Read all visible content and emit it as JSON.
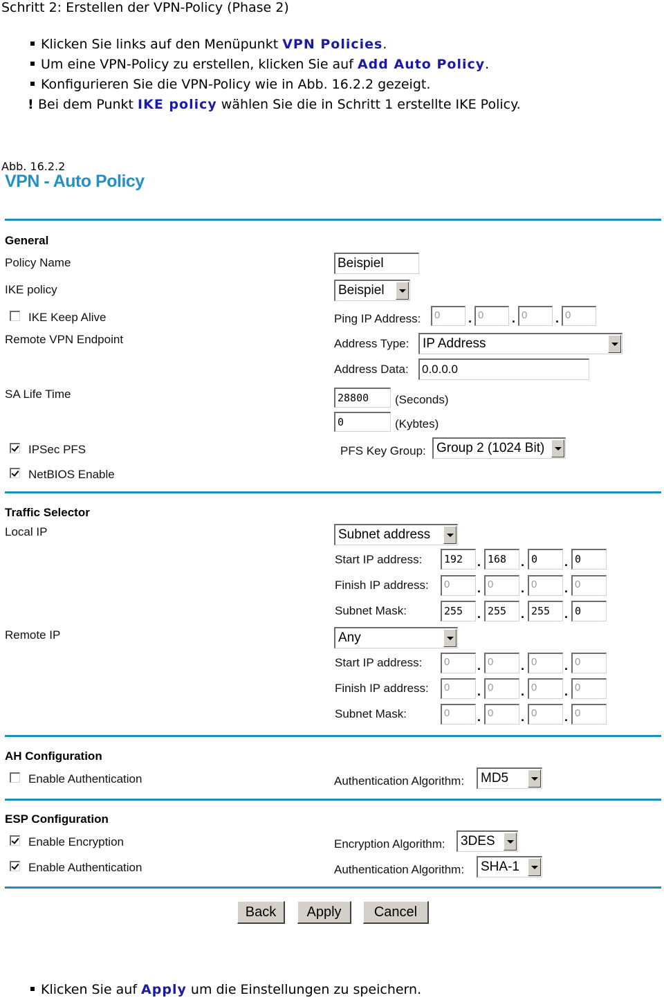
{
  "doc": {
    "title": "Schritt 2: Erstellen der VPN-Policy (Phase 2)",
    "bullets": [
      {
        "before": "Klicken Sie links auf den Menüpunkt ",
        "keyword": "VPN Policies",
        "after": "."
      },
      {
        "before": "Um eine VPN-Policy zu erstellen, klicken Sie auf ",
        "keyword": "Add Auto Policy",
        "after": "."
      },
      {
        "before": "Konfigurieren Sie die VPN-Policy wie in Abb. 16.2.2 gezeigt.",
        "keyword": "",
        "after": ""
      }
    ],
    "note": {
      "mark": "!",
      "before": "Bei dem Punkt ",
      "keyword": "IKE policy",
      "after": " wählen Sie die in Schritt 1 erstellte IKE Policy."
    },
    "caption": "Abb. 16.2.2",
    "footer_bullet": {
      "before": "Klicken Sie auf ",
      "keyword": "Apply",
      "after": " um die Einstellungen zu speichern."
    }
  },
  "colors": {
    "title": "#2391c4",
    "rule": "#1e8fbd",
    "keyword": "#1a1aa6"
  },
  "form": {
    "page_title": "VPN - Auto Policy",
    "general": {
      "heading": "General",
      "policy_name_label": "Policy Name",
      "policy_name_value": "Beispiel",
      "ike_policy_label": "IKE policy",
      "ike_policy_value": "Beispiel",
      "ike_keep_alive_label": "IKE Keep Alive",
      "ike_keep_alive_checked": false,
      "ping_ip_label": "Ping IP Address:",
      "ping_ip": [
        "0",
        "0",
        "0",
        "0"
      ],
      "remote_endpoint_label": "Remote VPN Endpoint",
      "address_type_label": "Address Type:",
      "address_type_value": "IP Address",
      "address_data_label": "Address Data:",
      "address_data_value": "0.0.0.0",
      "sa_life_label": "SA Life Time",
      "sa_seconds_value": "28800",
      "sa_seconds_unit": "(Seconds)",
      "sa_kbytes_value": "0",
      "sa_kbytes_unit": "(Kybtes)",
      "ipsec_pfs_label": "IPSec PFS",
      "ipsec_pfs_checked": true,
      "pfs_group_label": "PFS Key Group:",
      "pfs_group_value": "Group 2 (1024 Bit)",
      "netbios_label": "NetBIOS Enable",
      "netbios_checked": true
    },
    "traffic": {
      "heading": "Traffic Selector",
      "local_label": "Local IP",
      "local_type": "Subnet address",
      "local_start_label": "Start IP address:",
      "local_start": [
        "192",
        "168",
        "0",
        "0"
      ],
      "local_finish_label": "Finish IP address:",
      "local_finish": [
        "0",
        "0",
        "0",
        "0"
      ],
      "local_mask_label": "Subnet Mask:",
      "local_mask": [
        "255",
        "255",
        "255",
        "0"
      ],
      "remote_label": "Remote IP",
      "remote_type": "Any",
      "remote_start_label": "Start IP address:",
      "remote_start": [
        "0",
        "0",
        "0",
        "0"
      ],
      "remote_finish_label": "Finish IP address:",
      "remote_finish": [
        "0",
        "0",
        "0",
        "0"
      ],
      "remote_mask_label": "Subnet Mask:",
      "remote_mask": [
        "0",
        "0",
        "0",
        "0"
      ]
    },
    "ah": {
      "heading": "AH Configuration",
      "enable_auth_label": "Enable Authentication",
      "enable_auth_checked": false,
      "algo_label": "Authentication Algorithm:",
      "algo_value": "MD5"
    },
    "esp": {
      "heading": "ESP Configuration",
      "enable_enc_label": "Enable Encryption",
      "enable_enc_checked": true,
      "enc_algo_label": "Encryption Algorithm:",
      "enc_algo_value": "3DES",
      "enable_auth_label": "Enable Authentication",
      "enable_auth_checked": true,
      "auth_algo_label": "Authentication Algorithm:",
      "auth_algo_value": "SHA-1"
    },
    "buttons": {
      "back": "Back",
      "apply": "Apply",
      "cancel": "Cancel"
    }
  }
}
